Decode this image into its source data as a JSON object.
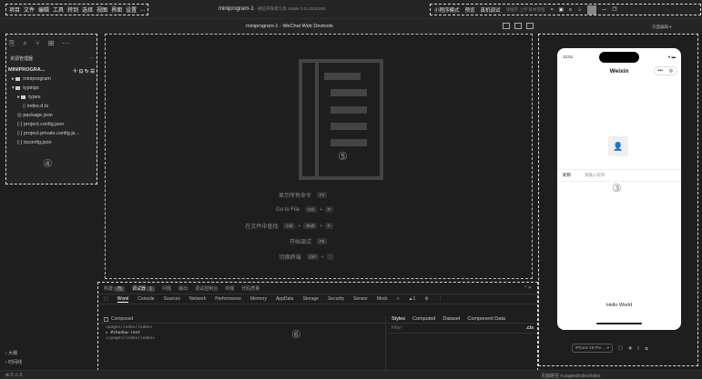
{
  "menu": [
    "项目",
    "文件",
    "编辑",
    "工具",
    "转到",
    "选择",
    "视图",
    "界面",
    "设置",
    "..."
  ],
  "window_title": "miniprogram-1",
  "window_title_suffix": "- 微信开发者工具 Stable 2.01.2510280",
  "toolbar_right": {
    "mode": "小程序模式",
    "preview": "预览",
    "real_debug": "真机调试",
    "dim_text": "清缓存 上传 版本管理"
  },
  "devtools_title": "miniprogram-1 - WeChat Web Devtools",
  "sim_controls": "页面编辑 ▾",
  "explorer": {
    "header": "资源管理器",
    "root": "MINIPROGRA...",
    "items": [
      "miniprogram",
      "typings",
      "types",
      "index.d.ts",
      "package.json",
      "project.config.json",
      "project.private.config.js...",
      "tsconfig.json"
    ],
    "marker": "④"
  },
  "editor": {
    "marker": "⑤",
    "shortcuts": [
      {
        "label": "显示所有命令",
        "keys": [
          "F1"
        ]
      },
      {
        "label": "Go to File",
        "keys": [
          "Ctrl",
          "P"
        ]
      },
      {
        "label": "在文件中查找",
        "keys": [
          "Ctrl",
          "Shift",
          "F"
        ]
      },
      {
        "label": "开始调试",
        "keys": [
          "F5"
        ]
      },
      {
        "label": "切换终端",
        "keys": [
          "Ctrl",
          "`"
        ]
      }
    ]
  },
  "devtools": {
    "top_tabs": [
      {
        "label": "构建",
        "badge": "75"
      },
      {
        "label": "调试器",
        "badge": "1"
      },
      {
        "label": "问题"
      },
      {
        "label": "输出"
      },
      {
        "label": "调试控制台"
      },
      {
        "label": "终端"
      },
      {
        "label": "代码质量"
      }
    ],
    "tabs": [
      "Wxml",
      "Console",
      "Sources",
      "Network",
      "Performance",
      "Memory",
      "AppData",
      "Storage",
      "Security",
      "Sensor",
      "Mock"
    ],
    "composed": "Composed",
    "code": [
      "<pages/index/index>",
      "▸ #shadow-root",
      "</pages/index/index>"
    ],
    "marker": "⑥",
    "styles_tabs": [
      "Styles",
      "Computed",
      "Dataset",
      "Component Data"
    ],
    "filter_placeholder": "Filter",
    "cls": ".cls",
    "warn_count": "1"
  },
  "simulator": {
    "time": "12:51",
    "battery": "▾ ▬",
    "nav_title": "Weixin",
    "capsule": [
      "•••",
      "◎"
    ],
    "nick_label": "昵称",
    "nick_placeholder": "请输入昵称",
    "marker": "③",
    "hello": "Hello World",
    "device": "iPhone 15 Pro ... ▾"
  },
  "outline": [
    "大纲",
    "时间线"
  ],
  "status_left": "⊗ 0 ⚠ 0",
  "status_right": "页面路径 ▾  pages/index/index"
}
